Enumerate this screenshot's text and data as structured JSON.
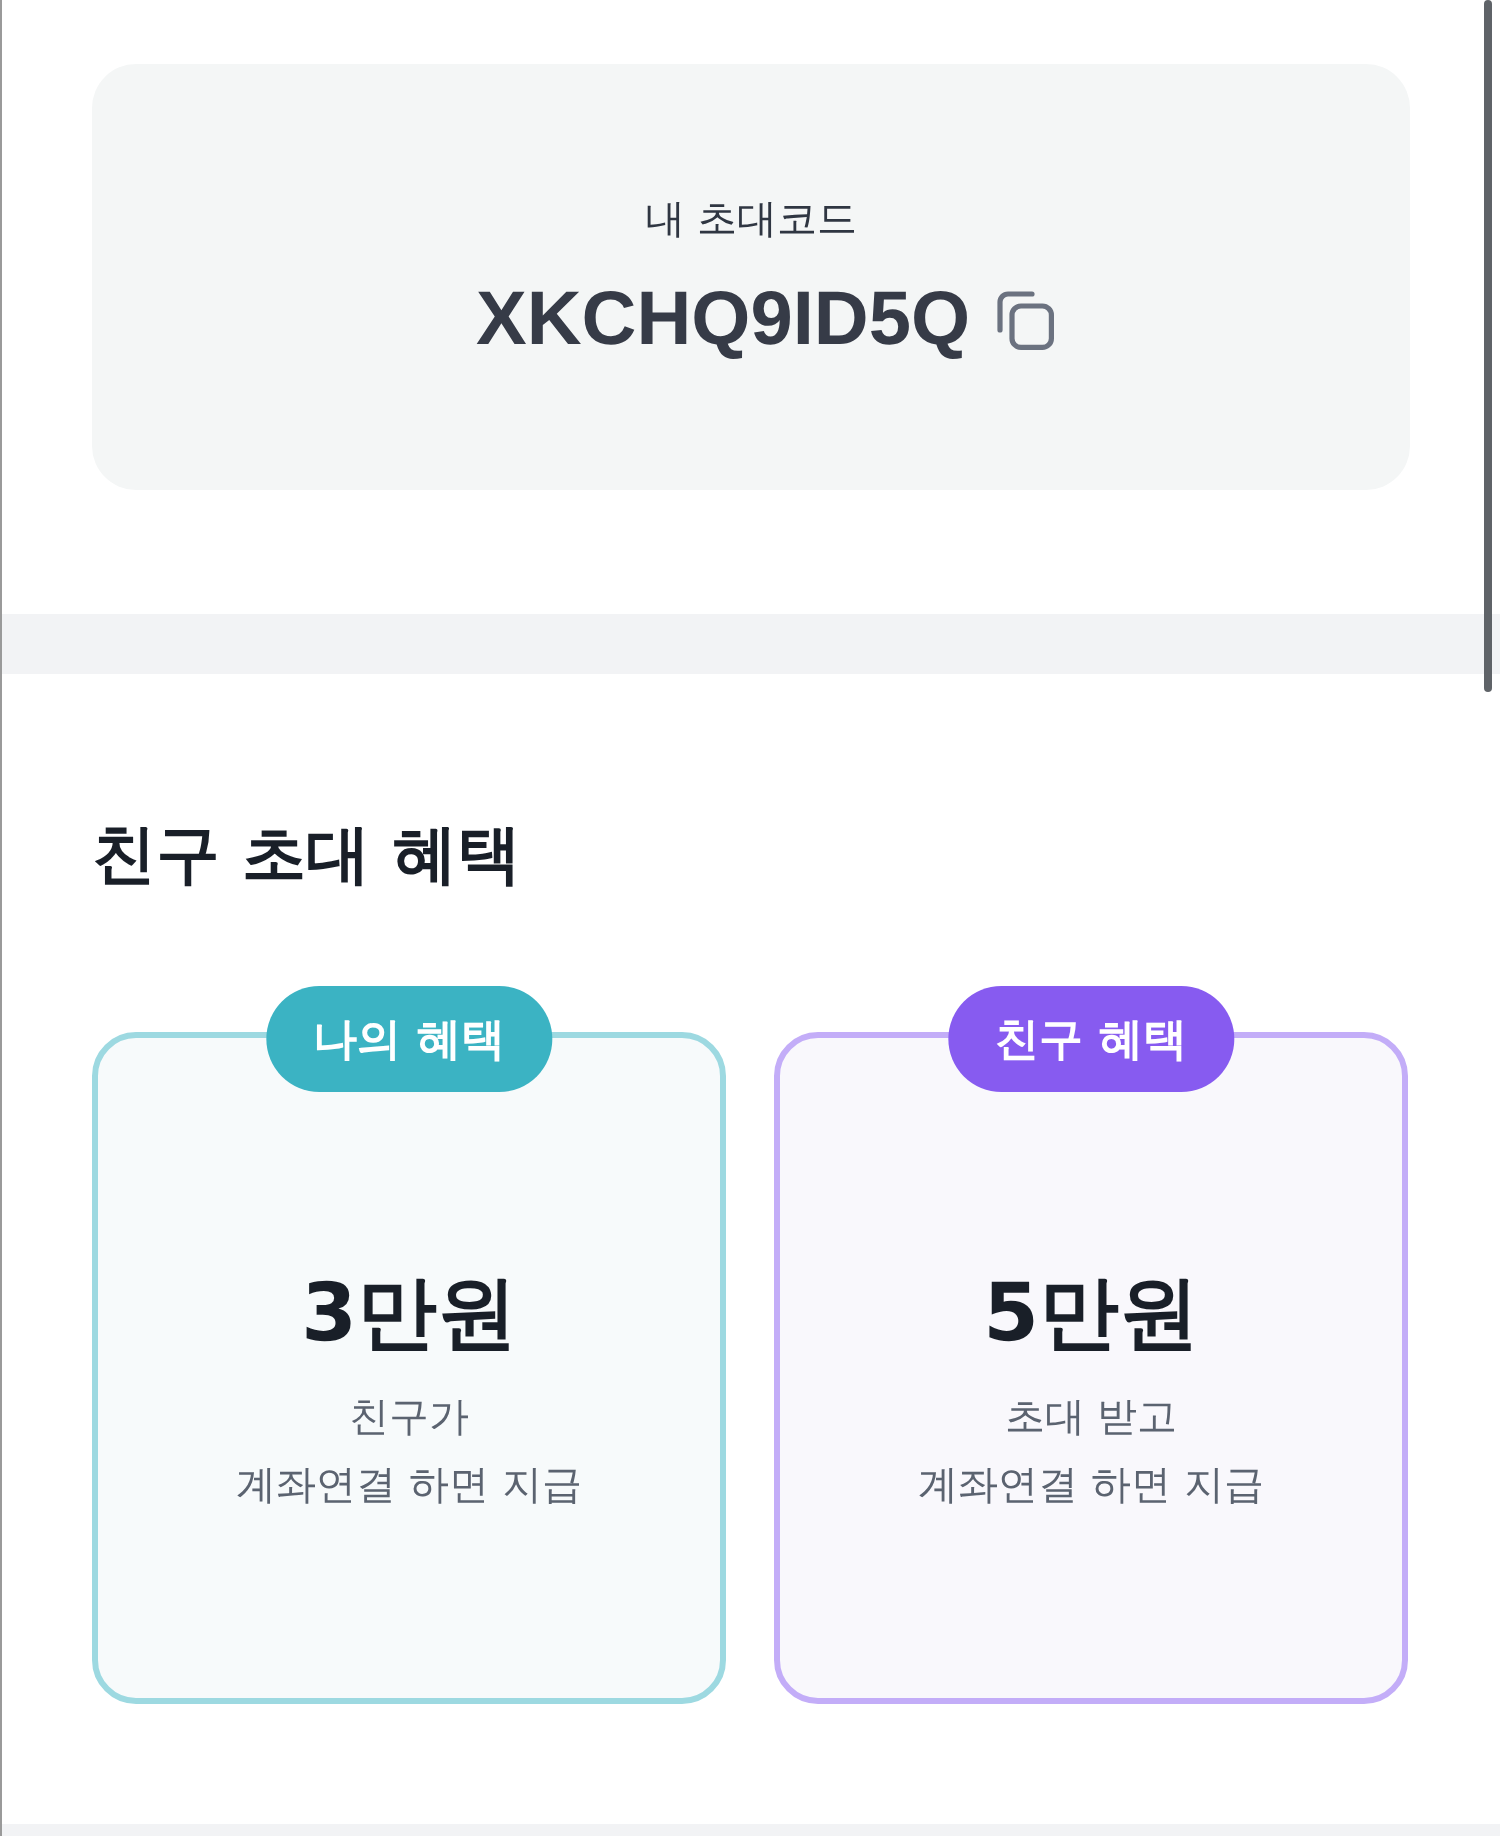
{
  "invite_code": {
    "label": "내 초대코드",
    "code": "XKCHQ9ID5Q"
  },
  "benefits": {
    "title": "친구 초대 혜택",
    "cards": [
      {
        "badge": "나의 혜택",
        "color": "#3bb3c3",
        "amount": "3만원",
        "description": "친구가\n계좌연결 하면 지급"
      },
      {
        "badge": "친구 혜택",
        "color": "#875bf0",
        "amount": "5만원",
        "description": "초대 받고\n계좌연결 하면 지급"
      }
    ]
  }
}
